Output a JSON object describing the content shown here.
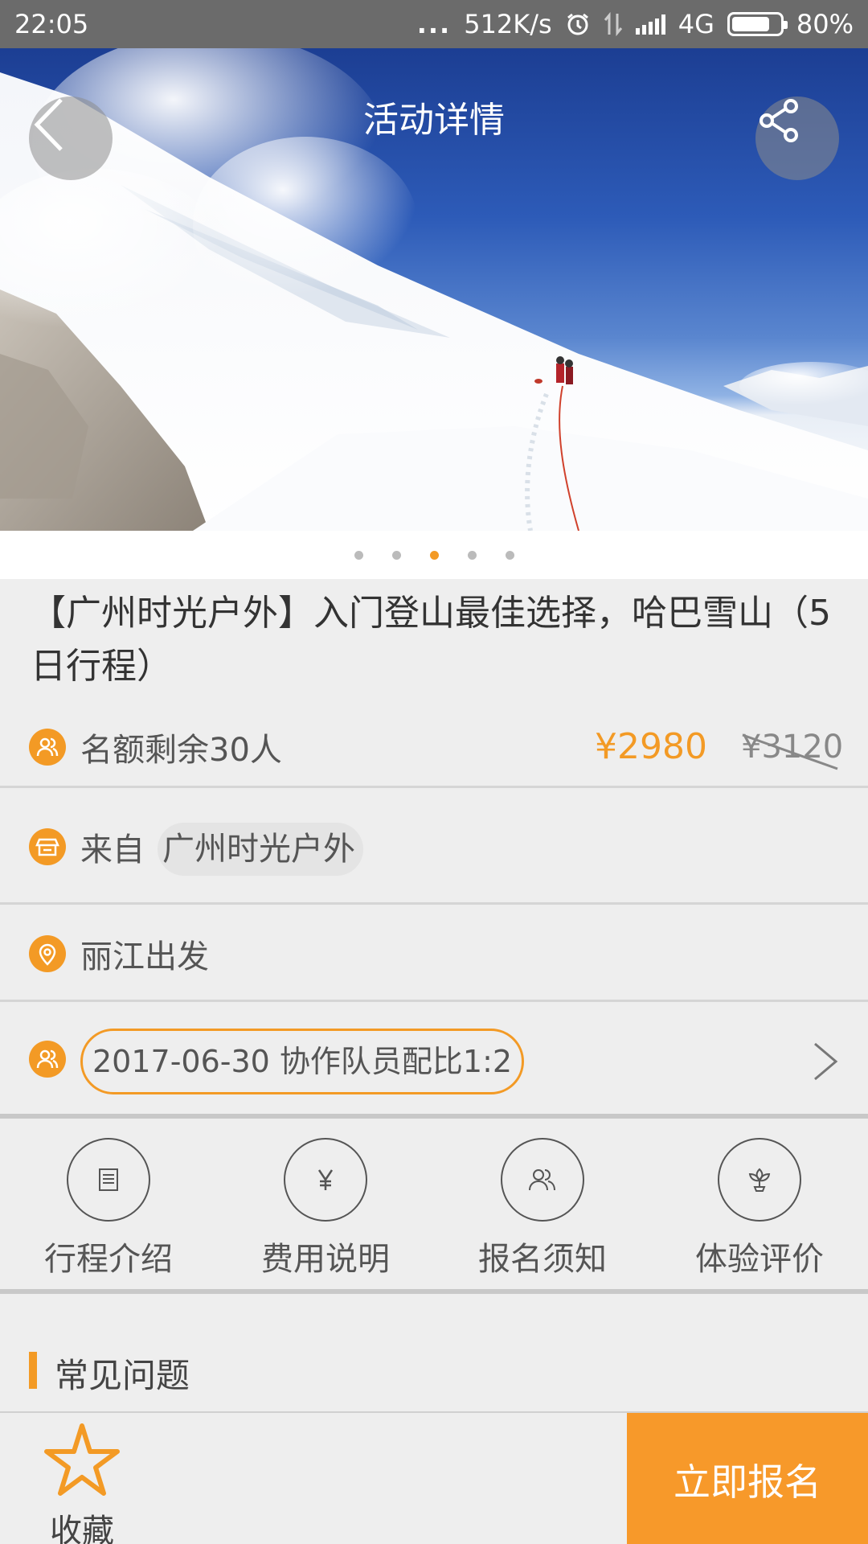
{
  "status_bar": {
    "time": "22:05",
    "dots": "...",
    "speed": "512K/s",
    "network": "4G",
    "battery_percent": "80%",
    "battery_level": 0.8
  },
  "header": {
    "title": "活动详情"
  },
  "carousel": {
    "total": 5,
    "active_index": 2
  },
  "activity": {
    "title": "【广州时光户外】入门登山最佳选择，哈巴雪山（5日行程）",
    "remaining": "名额剩余30人",
    "price_now": "¥2980",
    "price_old": "¥3120",
    "from_label": "来自",
    "organizer": "广州时光户外",
    "departure": "丽江出发",
    "date_info": "2017-06-30 协作队员配比1:2"
  },
  "tabs": [
    {
      "label": "行程介绍",
      "icon": "receipt-icon"
    },
    {
      "label": "费用说明",
      "icon": "yen-icon"
    },
    {
      "label": "报名须知",
      "icon": "people-icon"
    },
    {
      "label": "体验评价",
      "icon": "flower-icon"
    }
  ],
  "faq": {
    "label": "常见问题"
  },
  "bottom_bar": {
    "favorite_label": "收藏",
    "signup_label": "立即报名"
  },
  "colors": {
    "accent": "#f39a25",
    "status_bar": "#6b6b6b"
  }
}
